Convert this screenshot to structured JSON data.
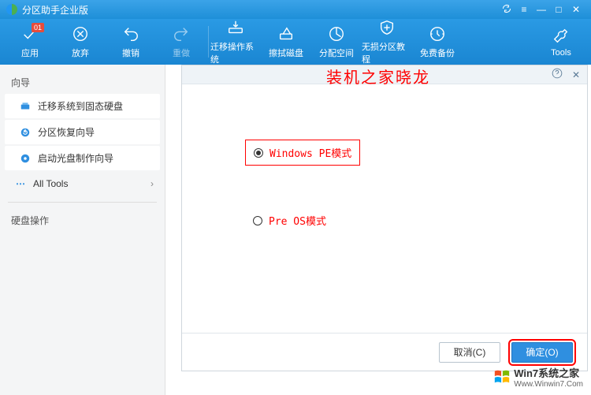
{
  "titlebar": {
    "title": "分区助手企业版"
  },
  "toolbar": {
    "apply": "应用",
    "apply_badge": "01",
    "discard": "放弃",
    "undo": "撤销",
    "redo": "重做",
    "migrate_os": "迁移操作系统",
    "wipe_disk": "擦拭磁盘",
    "alloc_space": "分配空间",
    "lossless_tutorial": "无损分区教程",
    "free_backup": "免费备份",
    "tools": "Tools"
  },
  "sidebar": {
    "wizard_title": "向导",
    "items": [
      {
        "label": "迁移系统到固态硬盘"
      },
      {
        "label": "分区恢复向导"
      },
      {
        "label": "启动光盘制作向导"
      }
    ],
    "all_tools": "All Tools",
    "disk_ops_title": "硬盘操作"
  },
  "dialog": {
    "watermark": "装机之家晓龙",
    "option_winpe": "Windows PE模式",
    "option_preos": "Pre OS模式",
    "cancel": "取消(C)",
    "ok": "确定(O)"
  },
  "brand": {
    "name": "Win7系统之家",
    "url": "Www.Winwin7.Com"
  }
}
